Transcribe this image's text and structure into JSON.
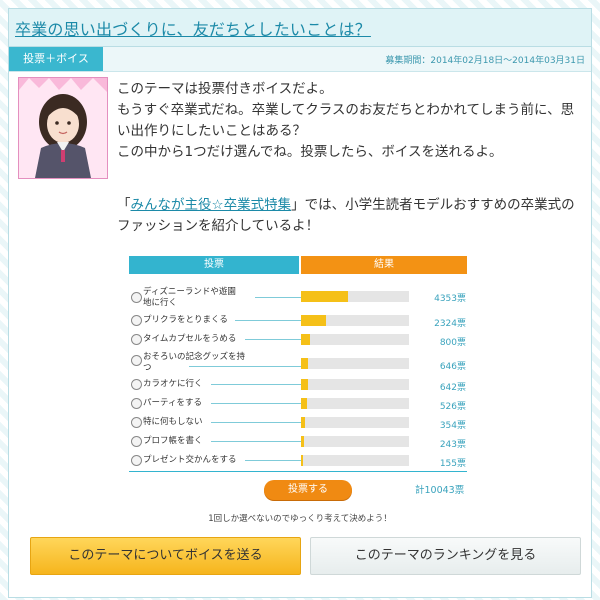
{
  "header": {
    "title": "卒業の思い出づくりに、友だちとしたいことは？",
    "tag": "投票＋ボイス",
    "period": "募集期間：2014年02月18日〜2014年03月31日"
  },
  "intro": {
    "line1": "このテーマは投票付きボイスだよ。",
    "line2": "もうすぐ卒業式だね。卒業してクラスのお友だちとわかれてしまう前に、思い出作りにしたいことはある？",
    "line3": "この中から1つだけ選んでね。投票したら、ボイスを送れるよ。"
  },
  "promo": {
    "bracket_open": "「",
    "link": "みんなが主役☆卒業式特集",
    "bracket_close": "」",
    "text": "では、小学生読者モデルおすすめの卒業式のファッションを紹介しているよ！"
  },
  "poll": {
    "header_vote": "投票",
    "header_result": "結果",
    "options": [
      {
        "label": "ディズニーランドや遊園地に行く",
        "votes": "4353票",
        "share": 0.4334
      },
      {
        "label": "プリクラをとりまくる",
        "votes": "2324票",
        "share": 0.2314
      },
      {
        "label": "タイムカプセルをうめる",
        "votes": "800票",
        "share": 0.0797
      },
      {
        "label": "おそろいの記念グッズを持つ",
        "votes": "646票",
        "share": 0.0643
      },
      {
        "label": "カラオケに行く",
        "votes": "642票",
        "share": 0.0639
      },
      {
        "label": "パーティをする",
        "votes": "526票",
        "share": 0.0524
      },
      {
        "label": "特に何もしない",
        "votes": "354票",
        "share": 0.0352
      },
      {
        "label": "プロフ帳を書く",
        "votes": "243票",
        "share": 0.0242
      },
      {
        "label": "プレゼント交かんをする",
        "votes": "155票",
        "share": 0.0154
      }
    ],
    "vote_button": "投票する",
    "total": "計10043票",
    "hint": "1回しか選べないのでゆっくり考えて決めよう！"
  },
  "actions": {
    "voice_button": "このテーマについてボイスを送る",
    "ranking_button": "このテーマのランキングを見る"
  },
  "colors": {
    "accent": "#33b4cf",
    "result": "#f39214",
    "bar_fill": "#f5c018",
    "count_text": "#3aa3bd"
  }
}
